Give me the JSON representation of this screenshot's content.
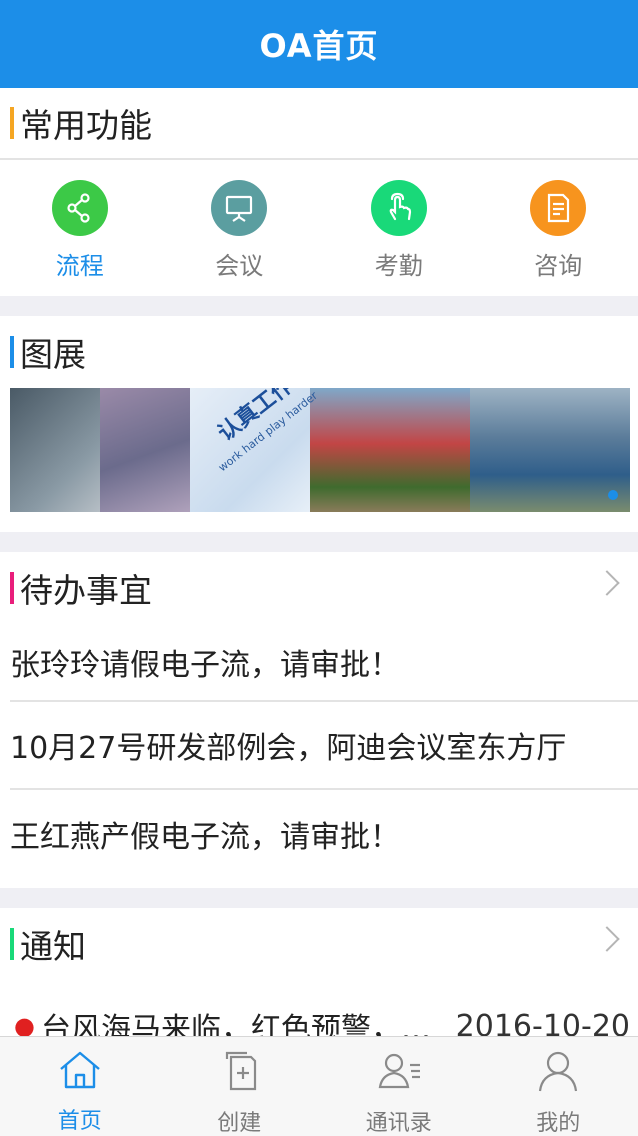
{
  "header": {
    "title": "OA首页"
  },
  "functions": {
    "title": "常用功能",
    "accent": "#f5a623",
    "items": [
      {
        "label": "流程",
        "icon": "share-nodes-icon",
        "color": "#3cc947",
        "active": true
      },
      {
        "label": "会议",
        "icon": "presentation-board-icon",
        "color": "#5b9ea0",
        "active": false
      },
      {
        "label": "考勤",
        "icon": "hand-tap-icon",
        "color": "#19d979",
        "active": false
      },
      {
        "label": "咨询",
        "icon": "document-icon",
        "color": "#f7941e",
        "active": false
      }
    ]
  },
  "gallery": {
    "title": "图展",
    "accent": "#1c8ee8",
    "banner_text": "认真工作 更要认真玩",
    "banner_sub": "work hard play harder"
  },
  "todo": {
    "title": "待办事宜",
    "accent": "#e91e7b",
    "items": [
      "张玲玲请假电子流，请审批！",
      "10月27号研发部例会，阿迪会议室东方厅",
      "王红燕产假电子流，请审批！"
    ]
  },
  "notice": {
    "title": "通知",
    "accent": "#19d979",
    "items": [
      {
        "text": "台风海马来临，红色预警，请大家注意安全",
        "date": "2016-10-20"
      }
    ]
  },
  "tabbar": {
    "items": [
      {
        "label": "首页",
        "icon": "home-icon",
        "active": true
      },
      {
        "label": "创建",
        "icon": "create-document-icon",
        "active": false
      },
      {
        "label": "通讯录",
        "icon": "contacts-icon",
        "active": false
      },
      {
        "label": "我的",
        "icon": "user-icon",
        "active": false
      }
    ]
  },
  "colors": {
    "primary": "#1c8ee8",
    "background": "#efeff4"
  }
}
